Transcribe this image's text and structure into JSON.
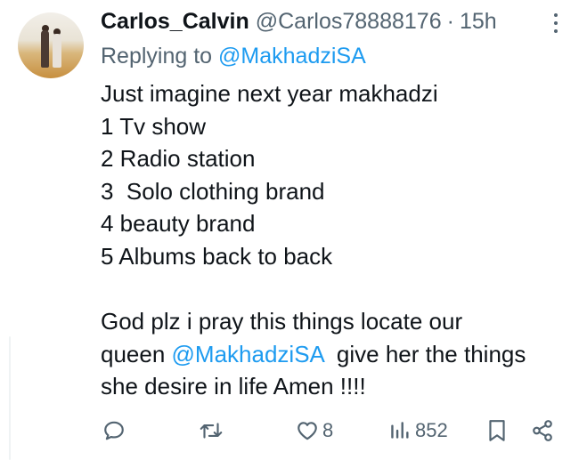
{
  "tweet": {
    "display_name": "Carlos_Calvin",
    "handle": "@Carlos78888176",
    "separator": "·",
    "time": "15h",
    "reply_prefix": "Replying to ",
    "reply_to": "@MakhadziSA",
    "lines": [
      "Just imagine next year makhadzi",
      "1 Tv show",
      "2 Radio station",
      "3  Solo clothing brand",
      "4 beauty brand",
      "5 Albums back to back"
    ],
    "para2": {
      "line1": "God plz i pray this things locate our",
      "line2_prefix": "queen ",
      "line2_mention": "@MakhadziSA",
      "line2_suffix": "  give her the things",
      "line3": "she desire in life Amen !!!!"
    }
  },
  "actions": {
    "likes": "8",
    "views": "852"
  },
  "icons": {
    "reply": "speech-bubble-icon",
    "retweet": "retweet-icon",
    "like": "heart-icon",
    "views": "bar-chart-icon",
    "bookmark": "bookmark-icon",
    "share": "share-icon",
    "more": "more-dots-icon"
  },
  "colors": {
    "text": "#0f1419",
    "secondary": "#536471",
    "link": "#1d9bf0"
  }
}
